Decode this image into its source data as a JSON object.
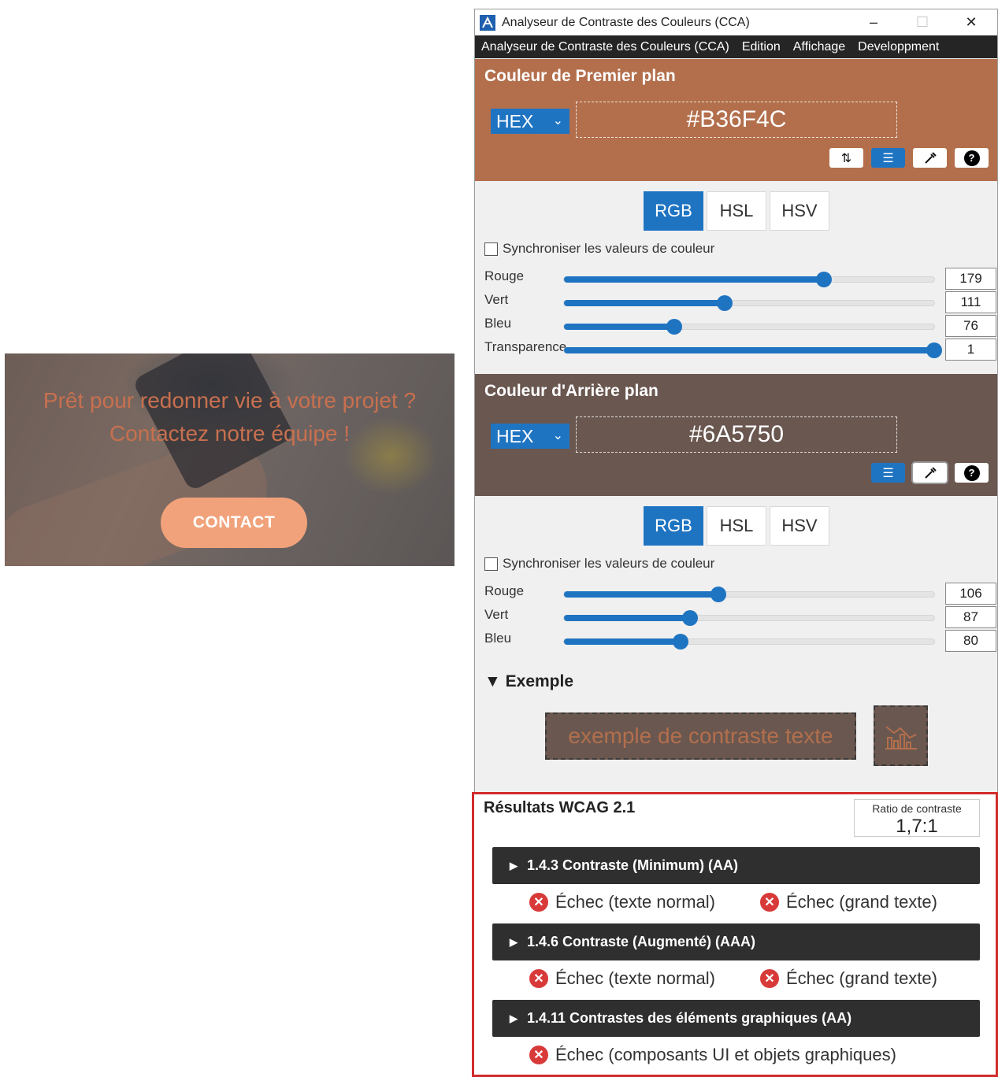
{
  "preview": {
    "headline_line1": "Prêt pour redonner vie à votre projet ?",
    "headline_line2": "Contactez notre équipe !",
    "button_label": "CONTACT"
  },
  "window": {
    "title": "Analyseur de Contraste des Couleurs (CCA)",
    "menu": [
      "Analyseur de Contraste des Couleurs (CCA)",
      "Edition",
      "Affichage",
      "Developpment"
    ]
  },
  "foreground": {
    "title": "Couleur de Premier plan",
    "format": "HEX",
    "hex": "#B36F4C",
    "color": "#b36f4c",
    "tabs": [
      "RGB",
      "HSL",
      "HSV"
    ],
    "sync_label": "Synchroniser les valeurs de couleur",
    "sliders": [
      {
        "label": "Rouge",
        "value": "179",
        "fraction": 0.702
      },
      {
        "label": "Vert",
        "value": "111",
        "fraction": 0.435
      },
      {
        "label": "Bleu",
        "value": "76",
        "fraction": 0.298
      },
      {
        "label": "Transparence",
        "value": "1",
        "fraction": 1.0
      }
    ]
  },
  "background": {
    "title": "Couleur d'Arrière plan",
    "format": "HEX",
    "hex": "#6A5750",
    "color": "#6a5750",
    "tabs": [
      "RGB",
      "HSL",
      "HSV"
    ],
    "sync_label": "Synchroniser les valeurs de couleur",
    "sliders": [
      {
        "label": "Rouge",
        "value": "106",
        "fraction": 0.416
      },
      {
        "label": "Vert",
        "value": "87",
        "fraction": 0.341
      },
      {
        "label": "Bleu",
        "value": "80",
        "fraction": 0.314
      }
    ]
  },
  "example": {
    "heading": "Exemple",
    "sample_text": "exemple de contraste texte"
  },
  "results": {
    "title": "Résultats WCAG 2.1",
    "ratio_label": "Ratio de contraste",
    "ratio_value": "1,7:1",
    "criteria": [
      {
        "label": "1.4.3 Contraste (Minimum) (AA)",
        "results": [
          "Échec (texte normal)",
          "Échec (grand texte)"
        ]
      },
      {
        "label": "1.4.6 Contraste (Augmenté) (AAA)",
        "results": [
          "Échec (texte normal)",
          "Échec (grand texte)"
        ]
      },
      {
        "label": "1.4.11 Contrastes des éléments graphiques (AA)",
        "results": [
          "Échec (composants UI et objets graphiques)"
        ]
      }
    ]
  },
  "colors": {
    "accent": "#1f74c2",
    "fail": "#d83a3a",
    "contact_button": "#f1a27a"
  }
}
